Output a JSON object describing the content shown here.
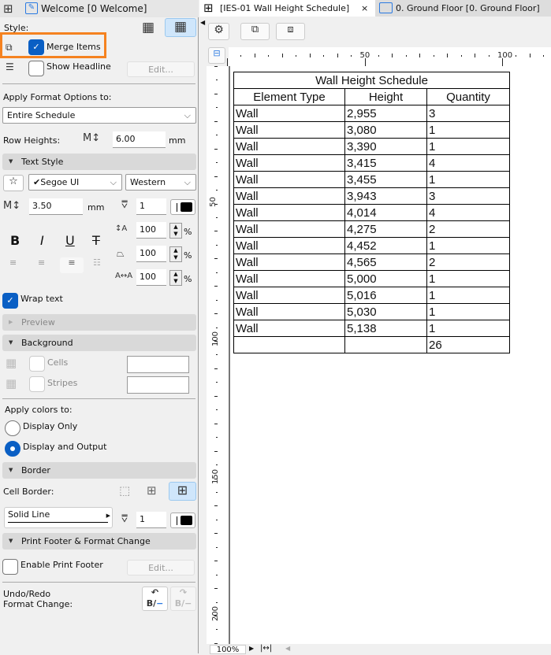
{
  "left": {
    "tab_title": "Welcome [0 Welcome]",
    "style_label": "Style:",
    "merge_items": {
      "label": "Merge Items",
      "checked": true
    },
    "show_headline": {
      "label": "Show Headline",
      "checked": false
    },
    "edit_label": "Edit...",
    "apply_format_label": "Apply Format Options to:",
    "apply_format_value": "Entire Schedule",
    "row_heights_label": "Row Heights:",
    "row_heights_value": "6.00",
    "unit_mm": "mm",
    "text_style": {
      "title": "Text Style",
      "font": "✔Segoe UI",
      "script": "Western",
      "size": "3.50",
      "pen": "1",
      "line_spacing": "100",
      "width_factor": "100",
      "char_spacing": "100",
      "percent": "%",
      "bold": "B",
      "italic": "I",
      "underline": "U",
      "strike": "T"
    },
    "wrap_text": {
      "label": "Wrap text",
      "checked": true
    },
    "preview_title": "Preview",
    "background": {
      "title": "Background",
      "cells": "Cells",
      "stripes": "Stripes"
    },
    "apply_colors_label": "Apply colors to:",
    "apply_colors_options": [
      {
        "label": "Display Only",
        "selected": false
      },
      {
        "label": "Display and Output",
        "selected": true
      }
    ],
    "border": {
      "title": "Border",
      "cell_border_label": "Cell Border:",
      "line_type": "Solid Line",
      "pen": "1"
    },
    "print_footer": {
      "title": "Print Footer & Format Change",
      "enable_label": "Enable Print Footer",
      "checked": false
    },
    "undo_redo_label_1": "Undo/Redo",
    "undo_redo_label_2": "Format Change:",
    "accent": "#0a5fc4",
    "highlight": "#f58220"
  },
  "right": {
    "tabs": [
      {
        "label": "[IES-01 Wall Height Schedule]",
        "active": true
      },
      {
        "label": "0. Ground Floor [0. Ground Floor]",
        "active": false
      }
    ],
    "close": "×",
    "ruler_h": [
      "50",
      "100"
    ],
    "ruler_v": [
      "50",
      "100",
      "150",
      "200"
    ],
    "zoom": "100%",
    "schedule": {
      "title": "Wall Height Schedule",
      "headers": [
        "Element Type",
        "Height",
        "Quantity"
      ],
      "rows": [
        [
          "Wall",
          "2,955",
          "3"
        ],
        [
          "Wall",
          "3,080",
          "1"
        ],
        [
          "Wall",
          "3,390",
          "1"
        ],
        [
          "Wall",
          "3,415",
          "4"
        ],
        [
          "Wall",
          "3,455",
          "1"
        ],
        [
          "Wall",
          "3,943",
          "3"
        ],
        [
          "Wall",
          "4,014",
          "4"
        ],
        [
          "Wall",
          "4,275",
          "2"
        ],
        [
          "Wall",
          "4,452",
          "1"
        ],
        [
          "Wall",
          "4,565",
          "2"
        ],
        [
          "Wall",
          "5,000",
          "1"
        ],
        [
          "Wall",
          "5,016",
          "1"
        ],
        [
          "Wall",
          "5,030",
          "1"
        ],
        [
          "Wall",
          "5,138",
          "1"
        ],
        [
          "",
          "",
          "26"
        ]
      ]
    }
  }
}
